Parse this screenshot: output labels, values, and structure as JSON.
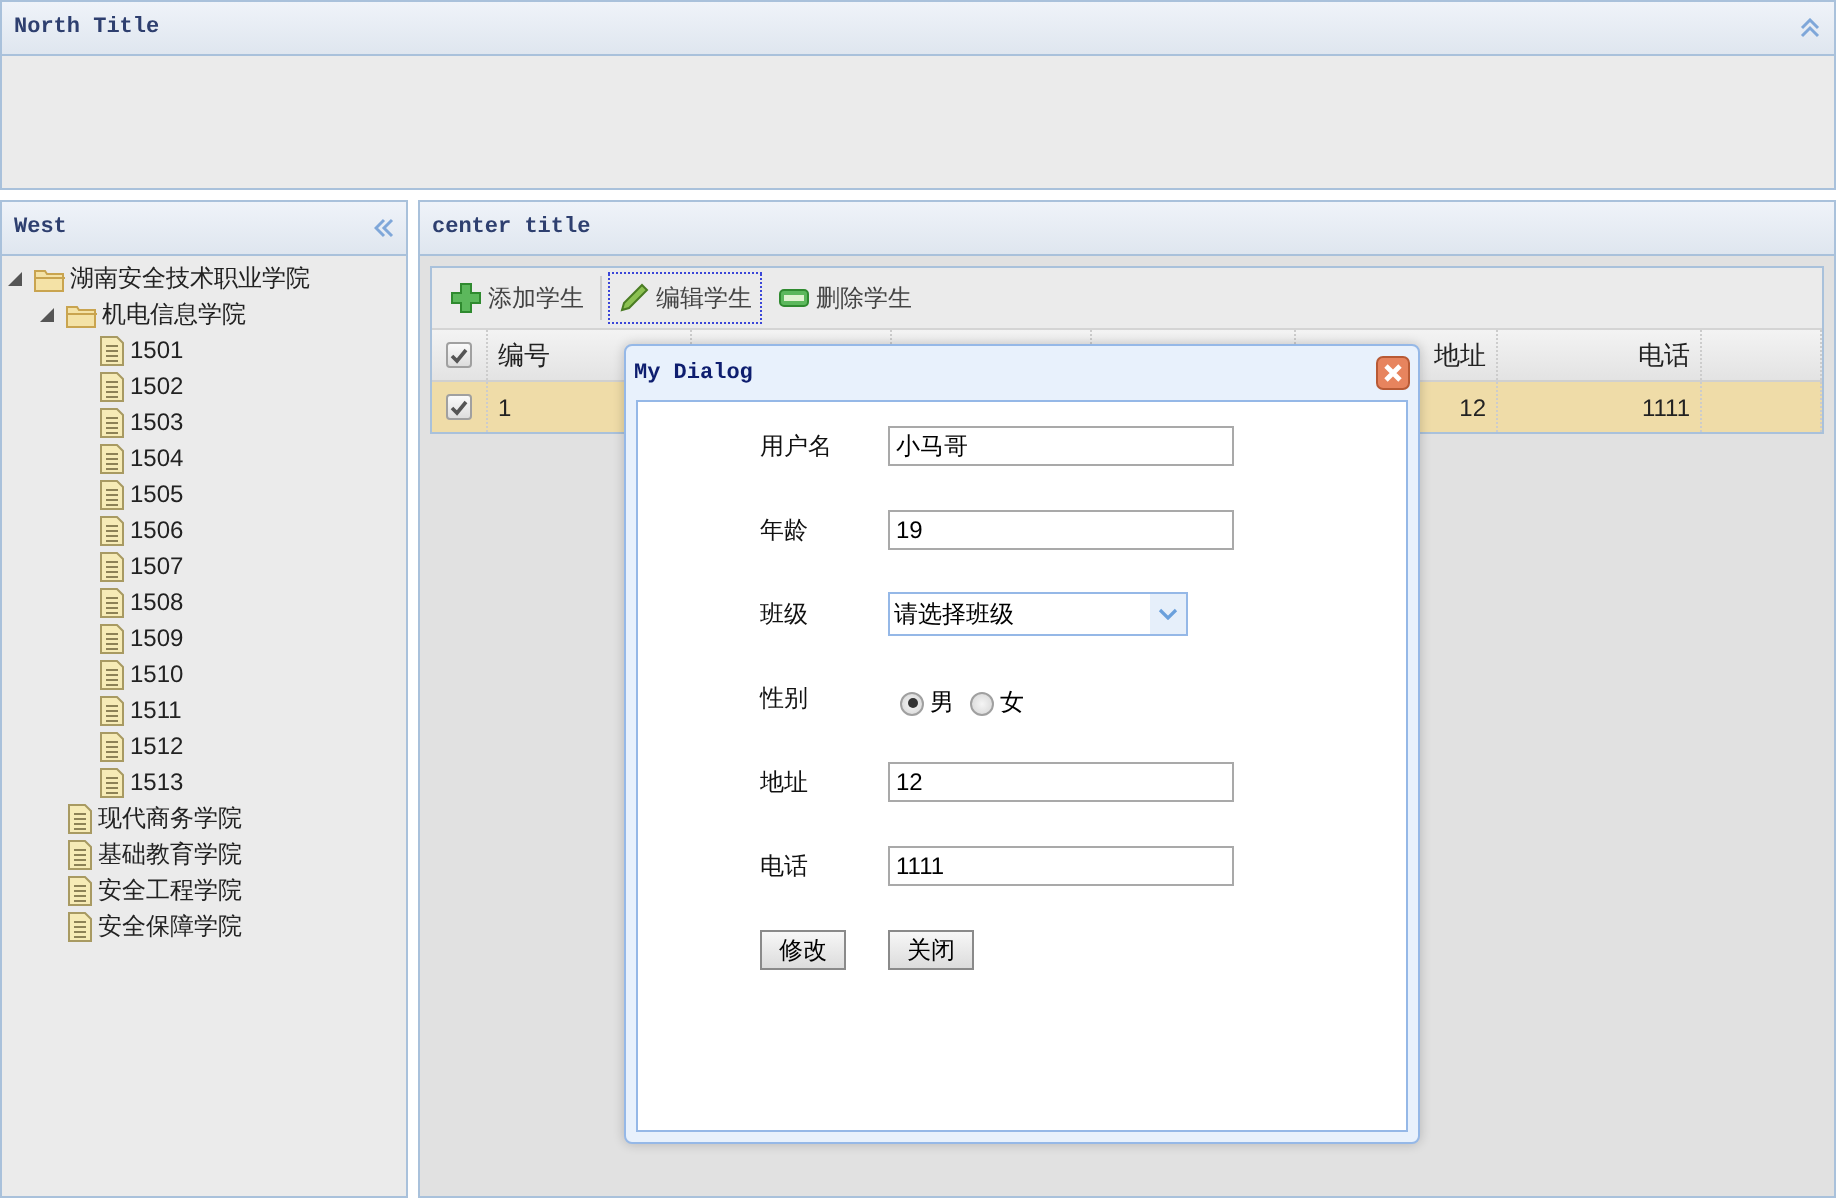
{
  "north": {
    "title": "North Title"
  },
  "west": {
    "title": "West",
    "tree": [
      {
        "label": "湖南安全技术职业学院",
        "kind": "folder",
        "expanded": true,
        "children": [
          {
            "label": "机电信息学院",
            "kind": "folder",
            "expanded": true,
            "children": [
              {
                "label": "1501",
                "kind": "file"
              },
              {
                "label": "1502",
                "kind": "file"
              },
              {
                "label": "1503",
                "kind": "file"
              },
              {
                "label": "1504",
                "kind": "file"
              },
              {
                "label": "1505",
                "kind": "file"
              },
              {
                "label": "1506",
                "kind": "file"
              },
              {
                "label": "1507",
                "kind": "file"
              },
              {
                "label": "1508",
                "kind": "file"
              },
              {
                "label": "1509",
                "kind": "file"
              },
              {
                "label": "1510",
                "kind": "file"
              },
              {
                "label": "1511",
                "kind": "file"
              },
              {
                "label": "1512",
                "kind": "file"
              },
              {
                "label": "1513",
                "kind": "file"
              }
            ]
          },
          {
            "label": "现代商务学院",
            "kind": "file"
          },
          {
            "label": "基础教育学院",
            "kind": "file"
          },
          {
            "label": "安全工程学院",
            "kind": "file"
          },
          {
            "label": "安全保障学院",
            "kind": "file"
          }
        ]
      }
    ]
  },
  "center": {
    "title": "center title",
    "toolbar": [
      {
        "label": "添加学生",
        "kind": "add",
        "focused": false
      },
      {
        "label": "编辑学生",
        "kind": "edit",
        "focused": true
      },
      {
        "label": "删除学生",
        "kind": "delete",
        "focused": false
      }
    ],
    "grid": {
      "all_checked": true,
      "columns": [
        "编号",
        null,
        null,
        null,
        "地址",
        "电话"
      ],
      "rows": [
        {
          "selected": true,
          "checked": true,
          "cells": [
            "1",
            null,
            null,
            null,
            "12",
            "1111"
          ]
        }
      ]
    }
  },
  "dialog": {
    "title": "My Dialog",
    "fields": [
      {
        "kind": "text",
        "label": "用户名",
        "value": "小马哥"
      },
      {
        "kind": "text",
        "label": "年龄",
        "value": "19"
      },
      {
        "kind": "select",
        "label": "班级",
        "value": "请选择班级"
      },
      {
        "kind": "radio",
        "label": "性别",
        "options": [
          {
            "label": "男",
            "selected": true
          },
          {
            "label": "女",
            "selected": false
          }
        ]
      },
      {
        "kind": "text",
        "label": "地址",
        "value": "12"
      },
      {
        "kind": "text",
        "label": "电话",
        "value": "1111"
      }
    ],
    "buttons": [
      "修改",
      "关闭"
    ]
  }
}
